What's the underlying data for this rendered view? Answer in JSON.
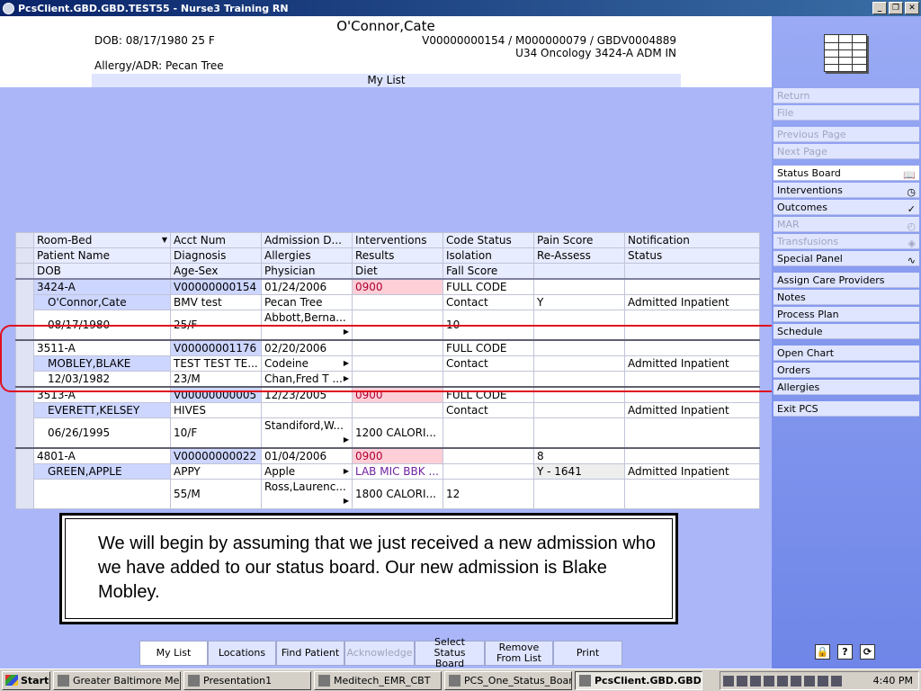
{
  "window": {
    "title": "PcsClient.GBD.GBD.TEST55 - Nurse3 Training RN"
  },
  "header": {
    "patient_name": "O'Connor,Cate",
    "dob": "DOB: 08/17/1980 25 F",
    "account": "V00000000154 / M000000079 / GBDV0004889",
    "unit": "U34 Oncology  3424-A  ADM IN",
    "allergy": "Allergy/ADR: Pecan Tree",
    "list_title": "My List"
  },
  "table": {
    "headers": [
      [
        "Room-Bed",
        "Acct Num",
        "Admission D...",
        "Interventions",
        "Code Status",
        "Pain Score",
        "Notification"
      ],
      [
        "Patient Name",
        "Diagnosis",
        "Allergies",
        "Results",
        "Isolation",
        "Re-Assess",
        "Status"
      ],
      [
        "DOB",
        "Age-Sex",
        "Physician",
        "Diet",
        "Fall Score",
        "",
        ""
      ]
    ],
    "patients": [
      {
        "rows": [
          [
            "3424-A",
            "V00000000154",
            "01/24/2006",
            "0900",
            "FULL CODE",
            "",
            ""
          ],
          [
            "O'Connor,Cate",
            "BMV test",
            "Pecan Tree",
            "",
            "Contact",
            "Y",
            "Admitted Inpatient"
          ],
          [
            "08/17/1980",
            "25/F",
            "Abbott,Berna...",
            "",
            "10",
            "",
            ""
          ]
        ]
      },
      {
        "rows": [
          [
            "3511-A",
            "V00000001176",
            "02/20/2006",
            "",
            "FULL CODE",
            "",
            ""
          ],
          [
            "MOBLEY,BLAKE",
            "TEST TEST TE...",
            "Codeine",
            "",
            "Contact",
            "",
            "Admitted Inpatient"
          ],
          [
            "12/03/1982",
            "23/M",
            "Chan,Fred T ...",
            "",
            "",
            "",
            ""
          ]
        ]
      },
      {
        "rows": [
          [
            "3513-A",
            "V00000000005",
            "12/23/2005",
            "0900",
            "FULL CODE",
            "",
            ""
          ],
          [
            "EVERETT,KELSEY",
            "HIVES",
            "",
            "",
            "Contact",
            "",
            "Admitted Inpatient"
          ],
          [
            "06/26/1995",
            "10/F",
            "Standiford,W...",
            "1200 CALORI...",
            "",
            "",
            ""
          ]
        ]
      },
      {
        "rows": [
          [
            "4801-A",
            "V00000000022",
            "01/04/2006",
            "0900",
            "",
            "8",
            ""
          ],
          [
            "GREEN,APPLE",
            "APPY",
            "Apple",
            "LAB MIC BBK ...",
            "",
            "Y - 1641",
            "Admitted Inpatient"
          ],
          [
            "",
            "55/M",
            "Ross,Laurenc...",
            "1800 CALORI...",
            "12",
            "",
            ""
          ]
        ]
      }
    ]
  },
  "caption": "We will begin by assuming that we just received a new admission who we have added to our status board. Our new admission is Blake Mobley.",
  "bottom_buttons": [
    "My List",
    "Locations",
    "Find Patient",
    "Acknowledge",
    "Select Status Board",
    "Remove From List",
    "Print"
  ],
  "sidebar": {
    "items": [
      "Return",
      "File",
      "Previous Page",
      "Next Page",
      "Status Board",
      "Interventions",
      "Outcomes",
      "MAR",
      "Transfusions",
      "Special Panel",
      "Assign Care Providers",
      "Notes",
      "Process Plan",
      "Schedule",
      "Open Chart",
      "Orders",
      "Allergies",
      "Exit PCS"
    ]
  },
  "taskbar": {
    "start": "Start",
    "tasks": [
      "Greater Baltimore Me...",
      "Presentation1",
      "Meditech_EMR_CBT",
      "PCS_One_Status_Board",
      "PcsClient.GBD.GBD...."
    ],
    "clock": "4:40 PM"
  },
  "colors": {
    "highlight": "#e0101e",
    "pink_cell": "#ffcfd8",
    "blue_cell": "#cdd6ff"
  }
}
